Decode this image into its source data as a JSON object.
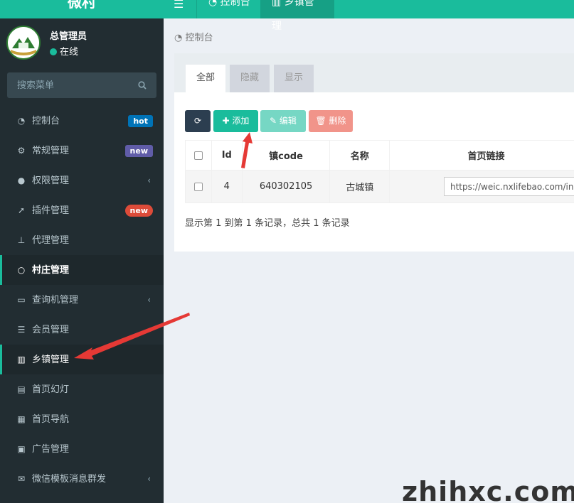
{
  "brand": {
    "logo_text": "微村"
  },
  "user": {
    "name": "总管理员",
    "status": "在线"
  },
  "search": {
    "placeholder": "搜索菜单"
  },
  "sidebar": {
    "items": [
      {
        "label": "控制台",
        "icon": "dashboard-icon",
        "badge": "hot"
      },
      {
        "label": "常规管理",
        "icon": "cogs-icon",
        "badge": "new"
      },
      {
        "label": "权限管理",
        "icon": "group-icon",
        "chevron": true
      },
      {
        "label": "插件管理",
        "icon": "rocket-icon",
        "badge": "new"
      },
      {
        "label": "代理管理",
        "icon": "sitemap-icon"
      },
      {
        "label": "村庄管理",
        "icon": "circle-icon"
      },
      {
        "label": "查询机管理",
        "icon": "laptop-icon",
        "chevron": true
      },
      {
        "label": "会员管理",
        "icon": "list-icon",
        "chevron": true
      },
      {
        "label": "乡镇管理",
        "icon": "bank-icon"
      },
      {
        "label": "首页幻灯",
        "icon": "film-icon"
      },
      {
        "label": "首页导航",
        "icon": "grid-icon"
      },
      {
        "label": "广告管理",
        "icon": "ad-icon"
      },
      {
        "label": "微信模板消息群发",
        "icon": "envelope-icon",
        "chevron": true
      }
    ]
  },
  "topbar": {
    "tabs": [
      {
        "label": "控制台"
      },
      {
        "label": "乡镇管理"
      }
    ]
  },
  "breadcrumb": {
    "label": "控制台"
  },
  "panel": {
    "tabs": [
      {
        "label": "全部"
      },
      {
        "label": "隐藏"
      },
      {
        "label": "显示"
      }
    ],
    "toolbar": {
      "add_label": "添加",
      "edit_label": "编辑",
      "delete_label": "删除"
    },
    "table": {
      "headers": [
        "Id",
        "镇code",
        "名称",
        "首页链接"
      ],
      "rows": [
        {
          "id": "4",
          "code": "640302105",
          "name": "古城镇",
          "link": "https://weic.nxlifebao.com/index.php"
        }
      ]
    },
    "footer": "显示第 1 到第 1 条记录，总共 1 条记录"
  },
  "watermark": "zhihxc.com",
  "colors": {
    "accent": "#1abc9c",
    "sidebar": "#222d32",
    "arrow": "#e53935"
  }
}
